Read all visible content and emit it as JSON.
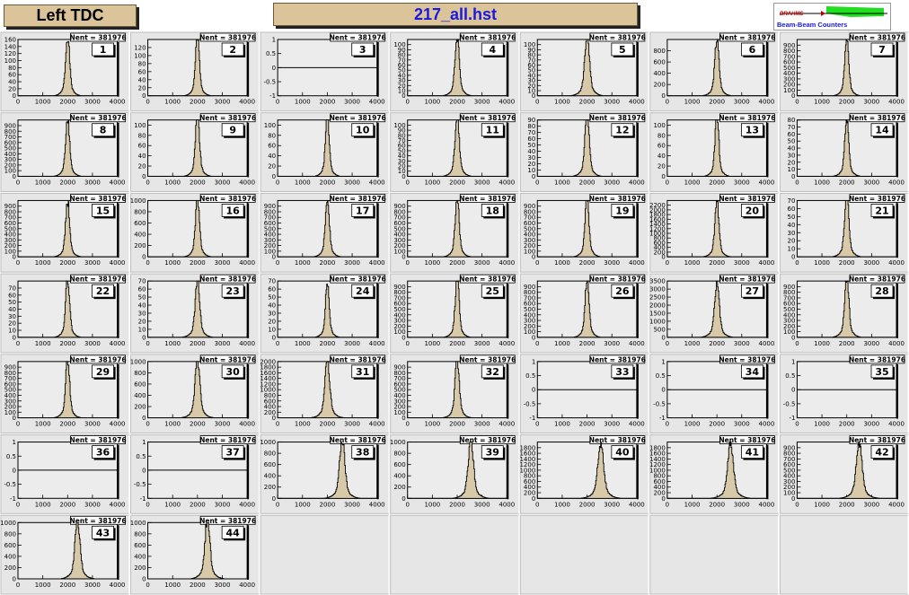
{
  "header": {
    "left_title": "Left TDC",
    "file_title": "217_all.hst",
    "logo_word": "BRAHMS",
    "logo_caption": "Beam-Beam Counters"
  },
  "colors": {
    "fill": "#d8c9a8",
    "pad_bg": "#e6e6e6",
    "frame": "#bdbdbd",
    "title_blue": "#1a1adc"
  },
  "chart_data": {
    "type": "histogram-grid",
    "stats_label": "Nent = 381976",
    "x_ticks": [
      "0",
      "1000",
      "2000",
      "3000",
      "4000"
    ],
    "xlim": [
      0,
      4000
    ],
    "peak_x": 2000,
    "pads": [
      {
        "id": "1",
        "ylim": [
          0,
          160
        ],
        "yticks": [
          "0",
          "20",
          "40",
          "60",
          "80",
          "100",
          "120",
          "140",
          "160"
        ],
        "peak": 145,
        "width": 75
      },
      {
        "id": "2",
        "ylim": [
          0,
          140
        ],
        "yticks": [
          "0",
          "20",
          "40",
          "60",
          "80",
          "100",
          "120"
        ],
        "peak": 125,
        "width": 75
      },
      {
        "id": "3",
        "empty": true,
        "ylim": [
          -1,
          1
        ],
        "yticks": [
          "-1",
          "-0.5",
          "0",
          "0.5",
          "1"
        ]
      },
      {
        "id": "4",
        "ylim": [
          0,
          110
        ],
        "yticks": [
          "0",
          "10",
          "20",
          "30",
          "40",
          "50",
          "60",
          "70",
          "80",
          "90",
          "100"
        ],
        "peak": 100,
        "width": 80
      },
      {
        "id": "5",
        "ylim": [
          0,
          110
        ],
        "yticks": [
          "0",
          "10",
          "20",
          "30",
          "40",
          "50",
          "60",
          "70",
          "80",
          "90",
          "100"
        ],
        "peak": 100,
        "width": 90
      },
      {
        "id": "6",
        "ylim": [
          0,
          1000
        ],
        "yticks": [
          "0",
          "200",
          "400",
          "600",
          "800"
        ],
        "peak": 850,
        "width": 80
      },
      {
        "id": "7",
        "ylim": [
          0,
          1000
        ],
        "yticks": [
          "0",
          "100",
          "200",
          "300",
          "400",
          "500",
          "600",
          "700",
          "800",
          "900"
        ],
        "peak": 900,
        "width": 75
      },
      {
        "id": "8",
        "ylim": [
          0,
          1000
        ],
        "yticks": [
          "0",
          "100",
          "200",
          "300",
          "400",
          "500",
          "600",
          "700",
          "800",
          "900"
        ],
        "peak": 900,
        "width": 75
      },
      {
        "id": "9",
        "ylim": [
          0,
          110
        ],
        "yticks": [
          "0",
          "20",
          "40",
          "60",
          "80",
          "100"
        ],
        "peak": 105,
        "width": 75
      },
      {
        "id": "10",
        "ylim": [
          0,
          110
        ],
        "yticks": [
          "0",
          "20",
          "40",
          "60",
          "80",
          "100"
        ],
        "peak": 105,
        "width": 70
      },
      {
        "id": "11",
        "ylim": [
          0,
          110
        ],
        "yticks": [
          "0",
          "10",
          "20",
          "30",
          "40",
          "50",
          "60",
          "70",
          "80",
          "90",
          "100"
        ],
        "peak": 100,
        "width": 80
      },
      {
        "id": "12",
        "ylim": [
          0,
          90
        ],
        "yticks": [
          "0",
          "10",
          "20",
          "30",
          "40",
          "50",
          "60",
          "70",
          "80",
          "90"
        ],
        "peak": 85,
        "width": 80
      },
      {
        "id": "13",
        "ylim": [
          0,
          110
        ],
        "yticks": [
          "0",
          "20",
          "40",
          "60",
          "80",
          "100"
        ],
        "peak": 105,
        "width": 70
      },
      {
        "id": "14",
        "ylim": [
          0,
          80
        ],
        "yticks": [
          "0",
          "10",
          "20",
          "30",
          "40",
          "50",
          "60",
          "70",
          "80"
        ],
        "peak": 70,
        "width": 75
      },
      {
        "id": "15",
        "ylim": [
          0,
          1000
        ],
        "yticks": [
          "0",
          "100",
          "200",
          "300",
          "400",
          "500",
          "600",
          "700",
          "800",
          "900"
        ],
        "peak": 850,
        "width": 75
      },
      {
        "id": "16",
        "ylim": [
          0,
          1000
        ],
        "yticks": [
          "0",
          "200",
          "400",
          "600",
          "800",
          "1000"
        ],
        "peak": 900,
        "width": 75
      },
      {
        "id": "17",
        "ylim": [
          0,
          1000
        ],
        "yticks": [
          "0",
          "100",
          "200",
          "300",
          "400",
          "500",
          "600",
          "700",
          "800",
          "900"
        ],
        "peak": 900,
        "width": 75
      },
      {
        "id": "18",
        "ylim": [
          0,
          1000
        ],
        "yticks": [
          "0",
          "100",
          "200",
          "300",
          "400",
          "500",
          "600",
          "700",
          "800",
          "900"
        ],
        "peak": 900,
        "width": 75
      },
      {
        "id": "19",
        "ylim": [
          0,
          1000
        ],
        "yticks": [
          "0",
          "100",
          "200",
          "300",
          "400",
          "500",
          "600",
          "700",
          "800",
          "900"
        ],
        "peak": 900,
        "width": 75
      },
      {
        "id": "20",
        "ylim": [
          0,
          2400
        ],
        "yticks": [
          "0",
          "200",
          "400",
          "600",
          "800",
          "1000",
          "1200",
          "1400",
          "1600",
          "1800",
          "2000",
          "2200"
        ],
        "peak": 2100,
        "width": 75
      },
      {
        "id": "21",
        "ylim": [
          0,
          70
        ],
        "yticks": [
          "0",
          "10",
          "20",
          "30",
          "40",
          "50",
          "60",
          "70"
        ],
        "peak": 65,
        "width": 80
      },
      {
        "id": "22",
        "ylim": [
          0,
          80
        ],
        "yticks": [
          "0",
          "10",
          "20",
          "30",
          "40",
          "50",
          "60",
          "70"
        ],
        "peak": 72,
        "width": 75
      },
      {
        "id": "23",
        "ylim": [
          0,
          70
        ],
        "yticks": [
          "0",
          "10",
          "20",
          "30",
          "40",
          "50",
          "60",
          "70"
        ],
        "peak": 60,
        "width": 85
      },
      {
        "id": "24",
        "ylim": [
          0,
          70
        ],
        "yticks": [
          "0",
          "10",
          "20",
          "30",
          "40",
          "50",
          "60",
          "70"
        ],
        "peak": 58,
        "width": 70
      },
      {
        "id": "25",
        "ylim": [
          0,
          1000
        ],
        "yticks": [
          "0",
          "100",
          "200",
          "300",
          "400",
          "500",
          "600",
          "700",
          "800",
          "900"
        ],
        "peak": 900,
        "width": 75
      },
      {
        "id": "26",
        "ylim": [
          0,
          1000
        ],
        "yticks": [
          "0",
          "100",
          "200",
          "300",
          "400",
          "500",
          "600",
          "700",
          "800",
          "900"
        ],
        "peak": 900,
        "width": 75
      },
      {
        "id": "27",
        "ylim": [
          0,
          3500
        ],
        "yticks": [
          "0",
          "500",
          "1000",
          "1500",
          "2000",
          "2500",
          "3000",
          "3500"
        ],
        "peak": 2900,
        "width": 90
      },
      {
        "id": "28",
        "ylim": [
          0,
          1000
        ],
        "yticks": [
          "0",
          "100",
          "200",
          "300",
          "400",
          "500",
          "600",
          "700",
          "800",
          "900"
        ],
        "peak": 900,
        "width": 80
      },
      {
        "id": "29",
        "ylim": [
          0,
          1000
        ],
        "yticks": [
          "0",
          "100",
          "200",
          "300",
          "400",
          "500",
          "600",
          "700",
          "800",
          "900"
        ],
        "peak": 900,
        "width": 75
      },
      {
        "id": "30",
        "ylim": [
          0,
          1000
        ],
        "yticks": [
          "0",
          "200",
          "400",
          "600",
          "800",
          "1000"
        ],
        "peak": 900,
        "width": 90
      },
      {
        "id": "31",
        "ylim": [
          0,
          2000
        ],
        "yticks": [
          "0",
          "200",
          "400",
          "600",
          "800",
          "1000",
          "1200",
          "1400",
          "1600",
          "1800",
          "2000"
        ],
        "peak": 1800,
        "width": 90
      },
      {
        "id": "32",
        "ylim": [
          0,
          1000
        ],
        "yticks": [
          "0",
          "100",
          "200",
          "300",
          "400",
          "500",
          "600",
          "700",
          "800",
          "900"
        ],
        "peak": 900,
        "width": 80
      },
      {
        "id": "33",
        "empty": true,
        "ylim": [
          -1,
          1
        ],
        "yticks": [
          "-1",
          "-0.5",
          "0",
          "0.5",
          "1"
        ]
      },
      {
        "id": "34",
        "empty": true,
        "ylim": [
          -1,
          1
        ],
        "yticks": [
          "-1",
          "-0.5",
          "0",
          "0.5",
          "1"
        ]
      },
      {
        "id": "35",
        "empty": true,
        "ylim": [
          -1,
          1
        ],
        "yticks": [
          "-1",
          "-0.5",
          "0",
          "0.5",
          "1"
        ]
      },
      {
        "id": "36",
        "empty": true,
        "ylim": [
          -1,
          1
        ],
        "yticks": [
          "-1",
          "-0.5",
          "0",
          "0.5",
          "1"
        ]
      },
      {
        "id": "37",
        "empty": true,
        "ylim": [
          -1,
          1
        ],
        "yticks": [
          "-1",
          "-0.5",
          "0",
          "0.5",
          "1"
        ]
      },
      {
        "id": "38",
        "ylim": [
          0,
          1000
        ],
        "yticks": [
          "0",
          "200",
          "400",
          "600",
          "800",
          "1000"
        ],
        "peak": 880,
        "width": 100,
        "center": 2600
      },
      {
        "id": "39",
        "ylim": [
          0,
          1000
        ],
        "yticks": [
          "0",
          "200",
          "400",
          "600",
          "800",
          "1000"
        ],
        "peak": 880,
        "width": 100,
        "center": 2550
      },
      {
        "id": "40",
        "ylim": [
          0,
          2000
        ],
        "yticks": [
          "0",
          "200",
          "400",
          "600",
          "800",
          "1000",
          "1200",
          "1400",
          "1600",
          "1800"
        ],
        "peak": 1700,
        "width": 110,
        "center": 2550
      },
      {
        "id": "41",
        "ylim": [
          0,
          2000
        ],
        "yticks": [
          "0",
          "200",
          "400",
          "600",
          "800",
          "1000",
          "1200",
          "1400",
          "1600",
          "1800"
        ],
        "peak": 1650,
        "width": 110,
        "center": 2550
      },
      {
        "id": "42",
        "ylim": [
          0,
          1000
        ],
        "yticks": [
          "0",
          "100",
          "200",
          "300",
          "400",
          "500",
          "600",
          "700",
          "800",
          "900"
        ],
        "peak": 850,
        "width": 110,
        "center": 2500
      },
      {
        "id": "43",
        "ylim": [
          0,
          1000
        ],
        "yticks": [
          "0",
          "200",
          "400",
          "600",
          "800",
          "1000"
        ],
        "peak": 900,
        "width": 95,
        "center": 2400
      },
      {
        "id": "44",
        "ylim": [
          0,
          1000
        ],
        "yticks": [
          "0",
          "200",
          "400",
          "600",
          "800",
          "1000"
        ],
        "peak": 900,
        "width": 95,
        "center": 2400
      }
    ]
  }
}
